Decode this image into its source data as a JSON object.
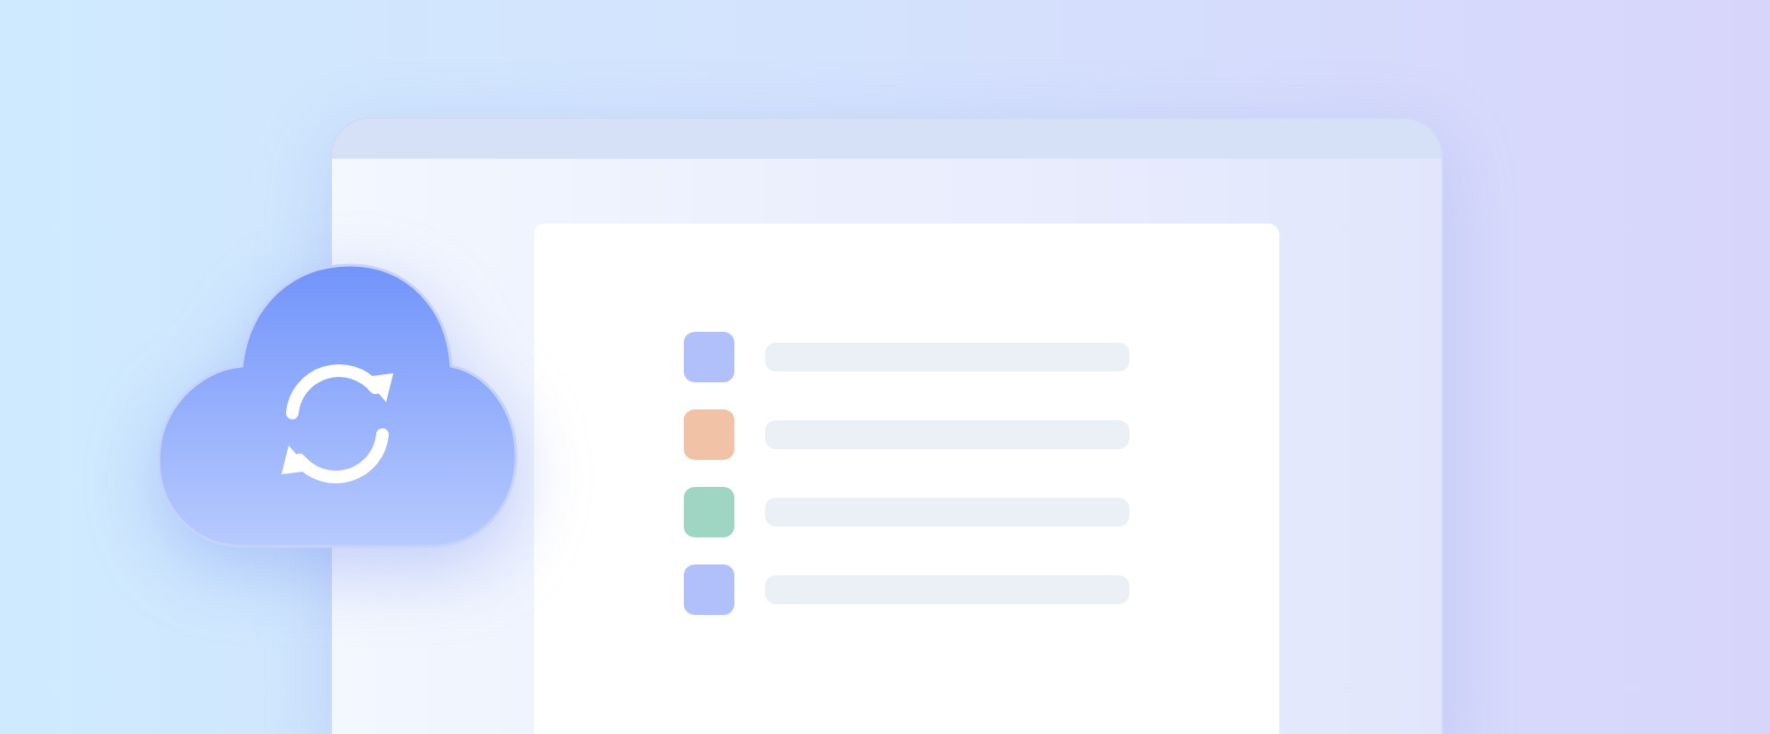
{
  "list_rows": [
    {
      "color": "#b1c0fb"
    },
    {
      "color": "#f1c2a6"
    },
    {
      "color": "#9fd6c3"
    },
    {
      "color": "#b1c0fb"
    }
  ]
}
